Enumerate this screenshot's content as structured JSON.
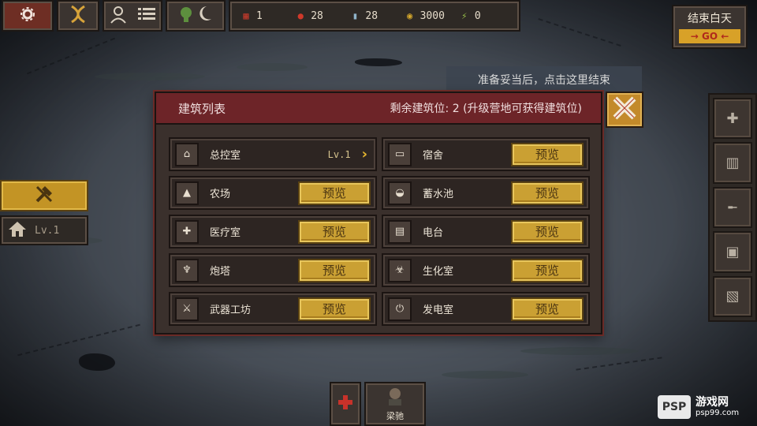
{
  "top_bar": {
    "settings_icon": "gear-icon",
    "dna_icon": "dna-icon",
    "survivors_icon": "survivor-icon",
    "list_icon": "list-icon",
    "weather_icon": "zombie-moon-icon"
  },
  "resources": [
    {
      "icon": "calendar-icon",
      "glyph": "▦",
      "value": "1",
      "color": "#c0392b"
    },
    {
      "icon": "food-icon",
      "glyph": "●",
      "value": "28",
      "color": "#d0392a"
    },
    {
      "icon": "water-icon",
      "glyph": "▮",
      "value": "28",
      "color": "#8fb3c9"
    },
    {
      "icon": "coins-icon",
      "glyph": "◉",
      "value": "3000",
      "color": "#d4a72c"
    },
    {
      "icon": "energy-icon",
      "glyph": "⚡",
      "value": "0",
      "color": "#9ac24a"
    }
  ],
  "end_day": {
    "label": "结束白天",
    "go": "→ GO ←"
  },
  "tooltip": "准备妥当后，点击这里结束",
  "left": {
    "build_icon": "hammer-icon",
    "level_label": "Lv.1"
  },
  "modal": {
    "title": "建筑列表",
    "slots_text": "剩余建筑位: 2 (升级营地可获得建筑位)",
    "close_icon": "close-icon",
    "preview_label": "预览",
    "buildings": [
      {
        "name": "总控室",
        "icon": "home-icon",
        "glyph": "⌂",
        "level": "Lv.1",
        "action": "arrow"
      },
      {
        "name": "宿舍",
        "icon": "bed-icon",
        "glyph": "▭",
        "action": "preview"
      },
      {
        "name": "农场",
        "icon": "farm-icon",
        "glyph": "▲",
        "action": "preview"
      },
      {
        "name": "蓄水池",
        "icon": "reservoir-icon",
        "glyph": "◒",
        "action": "preview"
      },
      {
        "name": "医疗室",
        "icon": "medkit-icon",
        "glyph": "✚",
        "action": "preview"
      },
      {
        "name": "电台",
        "icon": "radio-icon",
        "glyph": "▤",
        "action": "preview"
      },
      {
        "name": "炮塔",
        "icon": "turret-icon",
        "glyph": "♆",
        "action": "preview"
      },
      {
        "name": "生化室",
        "icon": "biohazard-icon",
        "glyph": "☣",
        "action": "preview"
      },
      {
        "name": "武器工坊",
        "icon": "weapon-workshop-icon",
        "glyph": "⚔",
        "action": "preview"
      },
      {
        "name": "发电室",
        "icon": "power-icon",
        "glyph": "⏻",
        "action": "preview"
      }
    ]
  },
  "side_panel": [
    {
      "name": "medkit-slot",
      "icon": "medkit-icon",
      "glyph": "✚"
    },
    {
      "name": "supplies-slot",
      "icon": "supplies-icon",
      "glyph": "▥"
    },
    {
      "name": "rifle-slot",
      "icon": "rifle-icon",
      "glyph": "╾"
    },
    {
      "name": "battery-slot",
      "icon": "battery-icon",
      "glyph": "▣"
    },
    {
      "name": "map-slot",
      "icon": "map-icon",
      "glyph": "▧"
    }
  ],
  "bottom": {
    "heal_icon": "red-cross-icon",
    "character_label": "梁驰"
  },
  "watermark": {
    "logo": "PSP",
    "title": "游戏网",
    "url": "psp99.com"
  }
}
